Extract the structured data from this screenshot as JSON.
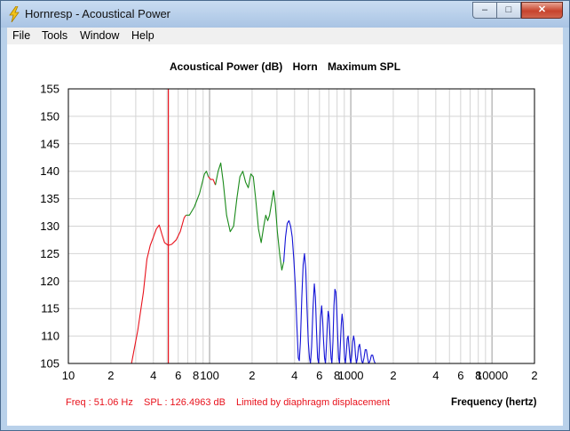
{
  "window": {
    "title": "Hornresp - Acoustical Power",
    "controls": {
      "minimize": "‒",
      "maximize": "□",
      "close": "✕"
    }
  },
  "menu": [
    {
      "label": "File"
    },
    {
      "label": "Tools"
    },
    {
      "label": "Window"
    },
    {
      "label": "Help"
    }
  ],
  "chart_header": {
    "quantity": "Acoustical Power (dB)",
    "device": "Horn",
    "mode": "Maximum SPL"
  },
  "status": {
    "freq": "Freq : 51.06 Hz",
    "spl": "SPL : 126.4963 dB",
    "note": "Limited by diaphragm displacement"
  },
  "colors": {
    "limited": "#e8121c",
    "normal": "#1a8a1a",
    "high": "#1212d6",
    "cursor": "#e8121c"
  },
  "chart_data": {
    "type": "line",
    "title": "Acoustical Power (dB)   Horn   Maximum SPL",
    "xlabel": "Frequency (hertz)",
    "ylabel": "",
    "x_scale": "log",
    "xlim": [
      10,
      20000
    ],
    "ylim": [
      105,
      155
    ],
    "y_ticks": [
      105,
      110,
      115,
      120,
      125,
      130,
      135,
      140,
      145,
      150,
      155
    ],
    "x_tick_labels": [
      {
        "value": 10,
        "label": "10"
      },
      {
        "value": 20,
        "label": "2"
      },
      {
        "value": 40,
        "label": "4"
      },
      {
        "value": 60,
        "label": "6"
      },
      {
        "value": 80,
        "label": "8"
      },
      {
        "value": 100,
        "label": "100"
      },
      {
        "value": 200,
        "label": "2"
      },
      {
        "value": 400,
        "label": "4"
      },
      {
        "value": 600,
        "label": "6"
      },
      {
        "value": 800,
        "label": "8"
      },
      {
        "value": 1000,
        "label": "1000"
      },
      {
        "value": 2000,
        "label": "2"
      },
      {
        "value": 4000,
        "label": "4"
      },
      {
        "value": 6000,
        "label": "6"
      },
      {
        "value": 8000,
        "label": "8"
      },
      {
        "value": 10000,
        "label": "10000"
      },
      {
        "value": 20000,
        "label": "2"
      }
    ],
    "cursor_x": 51.06,
    "series": [
      {
        "segment": "limited",
        "points": [
          [
            28,
            105
          ],
          [
            31,
            111
          ],
          [
            34,
            118
          ],
          [
            36,
            124
          ],
          [
            38,
            126.5
          ],
          [
            40,
            128
          ],
          [
            42,
            129.5
          ],
          [
            44,
            130.2
          ],
          [
            46,
            128.5
          ],
          [
            48,
            127
          ],
          [
            51.06,
            126.5
          ],
          [
            54,
            126.7
          ],
          [
            58,
            127.5
          ],
          [
            62,
            129
          ],
          [
            66,
            131.5
          ],
          [
            68,
            132
          ]
        ]
      },
      {
        "segment": "normal",
        "points": [
          [
            68,
            132
          ],
          [
            72,
            132
          ],
          [
            78,
            133.5
          ],
          [
            85,
            136
          ],
          [
            92,
            139.5
          ],
          [
            95,
            140
          ],
          [
            98,
            139
          ]
        ]
      },
      {
        "segment": "limited",
        "points": [
          [
            98,
            139
          ],
          [
            102,
            138.5
          ],
          [
            106,
            138.5
          ],
          [
            110,
            137.5
          ]
        ]
      },
      {
        "segment": "normal",
        "points": [
          [
            110,
            137.5
          ],
          [
            115,
            140
          ],
          [
            120,
            141.5
          ],
          [
            125,
            138
          ],
          [
            132,
            132
          ],
          [
            140,
            129
          ],
          [
            148,
            130
          ],
          [
            156,
            135
          ],
          [
            164,
            139
          ],
          [
            172,
            140
          ],
          [
            180,
            138
          ],
          [
            188,
            137
          ],
          [
            196,
            139.5
          ],
          [
            204,
            139
          ],
          [
            212,
            135
          ],
          [
            222,
            129.5
          ],
          [
            232,
            127
          ],
          [
            242,
            130
          ],
          [
            250,
            132
          ],
          [
            258,
            131
          ],
          [
            266,
            132
          ],
          [
            276,
            134.5
          ],
          [
            284,
            136.5
          ],
          [
            292,
            134
          ],
          [
            302,
            129
          ],
          [
            315,
            124.5
          ],
          [
            325,
            122
          ],
          [
            335,
            123.5
          ]
        ]
      },
      {
        "segment": "high",
        "points": [
          [
            335,
            123.5
          ],
          [
            345,
            128
          ],
          [
            355,
            130.5
          ],
          [
            365,
            131
          ],
          [
            375,
            130
          ],
          [
            385,
            128
          ],
          [
            395,
            124
          ],
          [
            405,
            119
          ],
          [
            415,
            112
          ],
          [
            425,
            106
          ],
          [
            432,
            105.5
          ],
          [
            440,
            109
          ],
          [
            450,
            117
          ],
          [
            460,
            123
          ],
          [
            470,
            125
          ],
          [
            480,
            122
          ],
          [
            490,
            115
          ],
          [
            500,
            109
          ],
          [
            510,
            106
          ],
          [
            518,
            105
          ],
          [
            528,
            108
          ],
          [
            540,
            115
          ],
          [
            552,
            119.5
          ],
          [
            562,
            117
          ],
          [
            572,
            111
          ],
          [
            582,
            106
          ],
          [
            592,
            105
          ],
          [
            602,
            109
          ],
          [
            612,
            113.5
          ],
          [
            622,
            115.5
          ],
          [
            632,
            113
          ],
          [
            642,
            109
          ],
          [
            652,
            106
          ],
          [
            662,
            105
          ],
          [
            672,
            108
          ],
          [
            682,
            112
          ],
          [
            692,
            114.5
          ],
          [
            702,
            113.5
          ],
          [
            712,
            110
          ],
          [
            725,
            106
          ],
          [
            735,
            105
          ],
          [
            748,
            109
          ],
          [
            760,
            115.5
          ],
          [
            772,
            118.5
          ],
          [
            784,
            118
          ],
          [
            796,
            114.5
          ],
          [
            808,
            110
          ],
          [
            820,
            106
          ],
          [
            832,
            105
          ],
          [
            844,
            108.5
          ],
          [
            856,
            112
          ],
          [
            868,
            114
          ],
          [
            880,
            112.5
          ],
          [
            892,
            109
          ],
          [
            904,
            106
          ],
          [
            916,
            105
          ],
          [
            930,
            107
          ],
          [
            944,
            109.5
          ],
          [
            958,
            110
          ],
          [
            972,
            108
          ],
          [
            986,
            106
          ],
          [
            1000,
            105
          ],
          [
            1016,
            106.5
          ],
          [
            1032,
            109
          ],
          [
            1048,
            110
          ],
          [
            1064,
            109
          ],
          [
            1080,
            106.5
          ],
          [
            1096,
            105
          ],
          [
            1115,
            106
          ],
          [
            1135,
            108
          ],
          [
            1155,
            108.5
          ],
          [
            1175,
            107
          ],
          [
            1195,
            105.5
          ],
          [
            1215,
            105
          ],
          [
            1240,
            106
          ],
          [
            1265,
            107.5
          ],
          [
            1290,
            107.5
          ],
          [
            1315,
            106
          ],
          [
            1340,
            105
          ],
          [
            1370,
            105.5
          ],
          [
            1400,
            106.5
          ],
          [
            1430,
            106.5
          ],
          [
            1460,
            105.5
          ],
          [
            1490,
            105
          ]
        ]
      }
    ]
  }
}
